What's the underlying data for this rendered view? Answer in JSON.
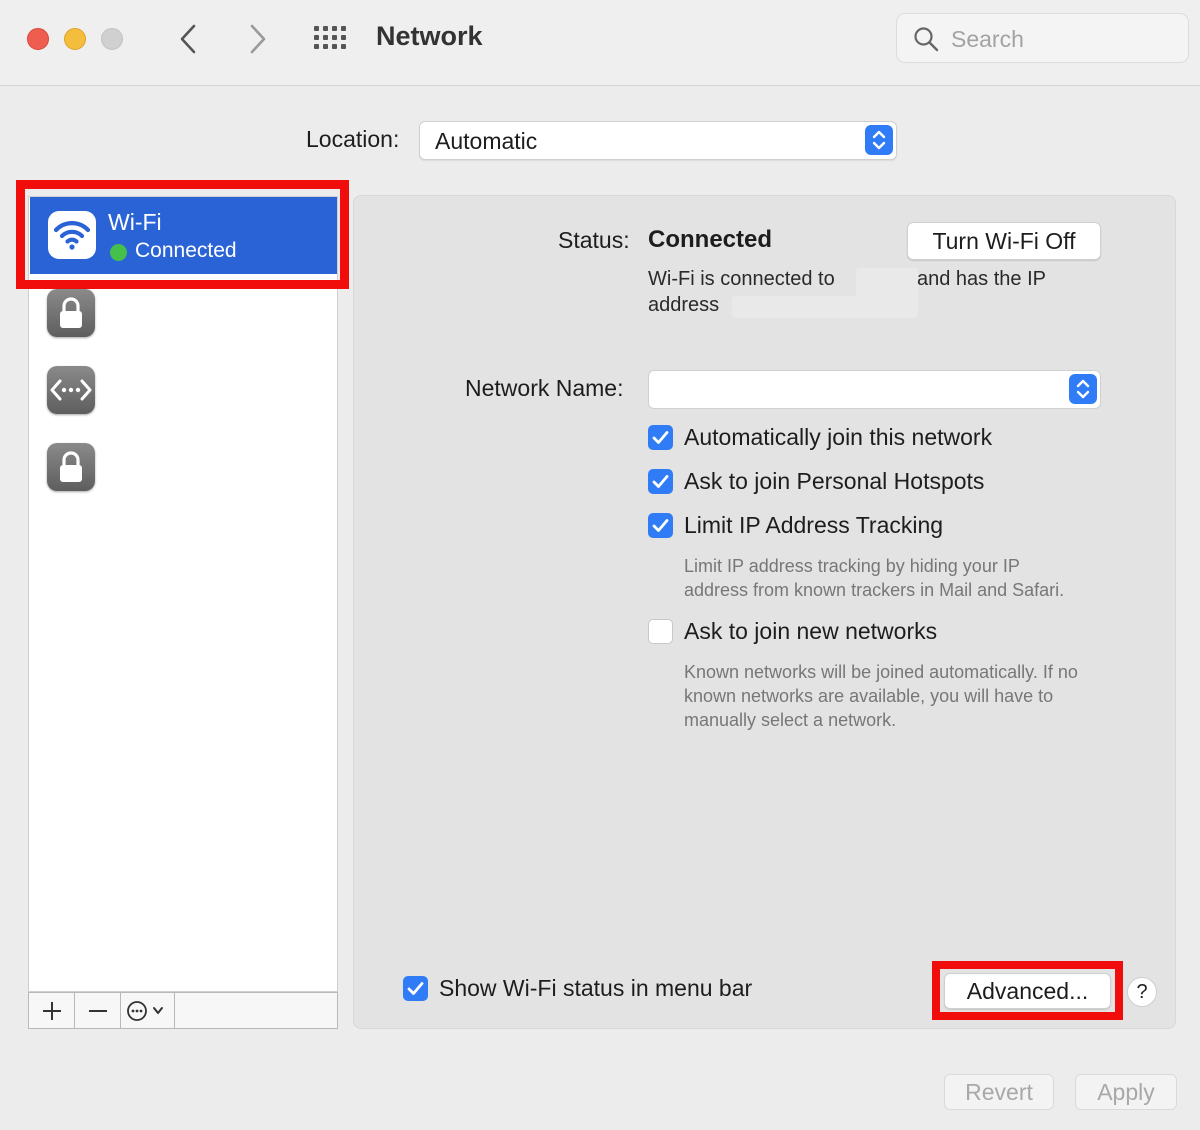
{
  "window": {
    "title": "Network",
    "search_placeholder": "Search"
  },
  "location": {
    "label": "Location:",
    "value": "Automatic"
  },
  "sidebar": {
    "items": [
      {
        "name": "Wi-Fi",
        "status": "Connected",
        "icon": "wifi-icon",
        "selected": true
      },
      {
        "name": "",
        "icon": "lock-icon"
      },
      {
        "name": "",
        "icon": "bridge-icon"
      },
      {
        "name": "",
        "icon": "lock-icon"
      }
    ]
  },
  "status": {
    "label": "Status:",
    "value": "Connected",
    "turn_off_label": "Turn Wi-Fi Off",
    "line1a": "Wi-Fi is connected to",
    "line1b": "and has the IP",
    "line2": "address"
  },
  "network_name": {
    "label": "Network Name:",
    "value": ""
  },
  "options": [
    {
      "label": "Automatically join this network",
      "checked": true
    },
    {
      "label": "Ask to join Personal Hotspots",
      "checked": true
    },
    {
      "label": "Limit IP Address Tracking",
      "checked": true,
      "hint": [
        "Limit IP address tracking by hiding your IP",
        "address from known trackers in Mail and Safari."
      ]
    },
    {
      "label": "Ask to join new networks",
      "checked": false,
      "hint": [
        "Known networks will be joined automatically. If no",
        "known networks are available, you will have to",
        "manually select a network."
      ]
    }
  ],
  "footer": {
    "show_status_label": "Show Wi-Fi status in menu bar",
    "show_status_checked": true,
    "advanced_label": "Advanced...",
    "help_label": "?",
    "revert_label": "Revert",
    "apply_label": "Apply"
  },
  "colors": {
    "accent": "#2f7cf6",
    "selection": "#2a63d6",
    "highlight": "#f20d0d",
    "connected": "#45c04a"
  }
}
